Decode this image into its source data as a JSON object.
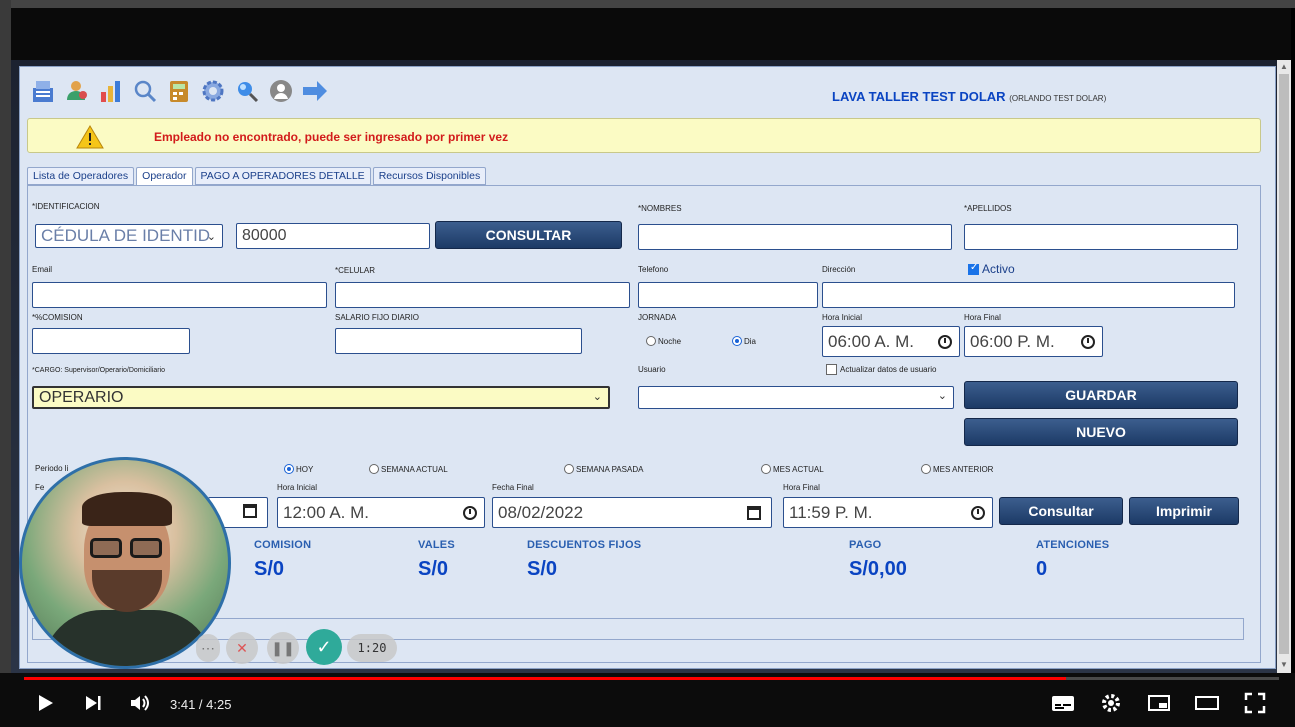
{
  "company": {
    "name": "LAVA TALLER TEST DOLAR",
    "sub": "(ORLANDO TEST DOLAR)"
  },
  "alert": {
    "message": "Empleado no encontrado, puede ser ingresado por primer vez"
  },
  "tabs": [
    "Lista de Operadores",
    "Operador",
    "PAGO A OPERADORES DETALLE",
    "Recursos Disponibles"
  ],
  "form": {
    "identificacion_label": "*IDENTIFICACION",
    "id_type": "CÉDULA DE IDENTID",
    "id_value": "80000",
    "consultar_btn": "CONSULTAR",
    "nombres_label": "*NOMBRES",
    "apellidos_label": "*APELLIDOS",
    "email_label": "Email",
    "celular_label": "*CELULAR",
    "telefono_label": "Telefono",
    "direccion_label": "Dirección",
    "activo_label": "Activo",
    "comision_label": "*%COMISION",
    "salario_label": "SALARIO FIJO DIARIO",
    "jornada_label": "JORNADA",
    "noche_label": "Noche",
    "dia_label": "Dia",
    "hora_inicial_label": "Hora Inicial",
    "hora_final_label": "Hora Final",
    "hora_inicial_value": "06:00 A. M.",
    "hora_final_value": "06:00 P. M.",
    "cargo_label": "*CARGO: Supervisor/Operario/Domiciliario",
    "cargo_value": "OPERARIO",
    "usuario_label": "Usuario",
    "actualizar_label": "Actualizar datos de usuario",
    "guardar_btn": "GUARDAR",
    "nuevo_btn": "NUEVO"
  },
  "periodo": {
    "periodo_label": "Periodo li",
    "fecha_label": "Fe",
    "hoy": "HOY",
    "semana_actual": "SEMANA ACTUAL",
    "semana_pasada": "SEMANA PASADA",
    "mes_actual": "MES ACTUAL",
    "mes_anterior": "MES ANTERIOR",
    "hora_inicial_label": "Hora Inicial",
    "hora_inicial_value": "12:00 A. M.",
    "fecha_final_label": "Fecha Final",
    "fecha_final_value": "08/02/2022",
    "hora_final_label": "Hora Final",
    "hora_final_value": "11:59 P. M.",
    "consultar_btn": "Consultar",
    "imprimir_btn": "Imprimir"
  },
  "summary": {
    "comision_label": "COMISION",
    "comision_value": "S/0",
    "vales_label": "VALES",
    "vales_value": "S/0",
    "descuentos_label": "DESCUENTOS FIJOS",
    "descuentos_value": "S/0",
    "pago_label": "PAGO",
    "pago_value": "S/0,00",
    "atenciones_label": "ATENCIONES",
    "atenciones_value": "0"
  },
  "recorder": {
    "timer": "1:20"
  },
  "player": {
    "time": "3:41 / 4:25",
    "progress_fraction": 0.83
  },
  "icons": [
    "register-icon",
    "users-icon",
    "chart-icon",
    "search-icon",
    "calculator-icon",
    "gear-icon",
    "magnifier-icon",
    "user-circle-icon",
    "arrow-right-icon"
  ]
}
